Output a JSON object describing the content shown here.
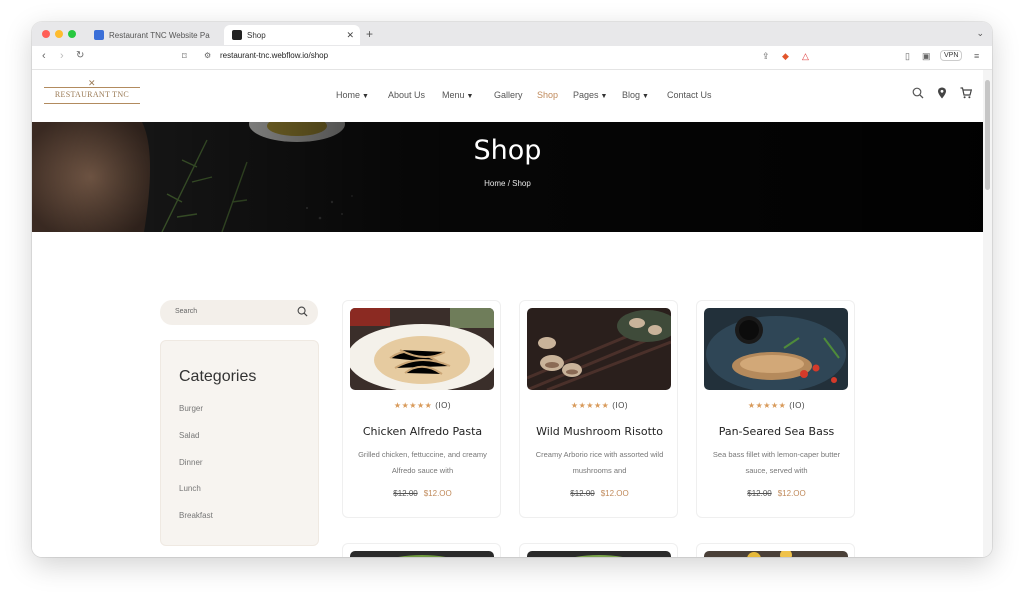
{
  "browser": {
    "tabs": [
      {
        "label": "Restaurant TNC Website Page Tr"
      },
      {
        "label": "Shop"
      }
    ],
    "url": "restaurant-tnc.webflow.io/shop",
    "vpn_label": "VPN"
  },
  "site": {
    "logo_text": "RESTAURANT TNC",
    "nav": [
      {
        "label": "Home",
        "dropdown": true
      },
      {
        "label": "About Us",
        "dropdown": false
      },
      {
        "label": "Menu",
        "dropdown": true
      },
      {
        "label": "Gallery",
        "dropdown": false
      },
      {
        "label": "Shop",
        "dropdown": false
      },
      {
        "label": "Pages",
        "dropdown": true
      },
      {
        "label": "Blog",
        "dropdown": true
      },
      {
        "label": "Contact Us",
        "dropdown": false
      }
    ]
  },
  "hero": {
    "title": "Shop",
    "breadcrumb": "Home / Shop"
  },
  "sidebar": {
    "search_placeholder": "Search",
    "categories_title": "Categories",
    "categories": [
      "Burger",
      "Salad",
      "Dinner",
      "Lunch",
      "Breakfast"
    ]
  },
  "products": [
    {
      "title": "Chicken Alfredo Pasta",
      "description": "Grilled chicken, fettuccine, and creamy Alfredo sauce with",
      "rating_count": "(IO)",
      "old_price": "$12.00",
      "price": "$12.OO"
    },
    {
      "title": "Wild Mushroom Risotto",
      "description": "Creamy Arborio rice with assorted wild mushrooms and",
      "rating_count": "(IO)",
      "old_price": "$12.00",
      "price": "$12.OO"
    },
    {
      "title": "Pan-Seared Sea Bass",
      "description": "Sea bass fillet with lemon-caper butter sauce, served with",
      "rating_count": "(IO)",
      "old_price": "$12.00",
      "price": "$12.OO"
    }
  ],
  "colors": {
    "accent": "#c08a5b",
    "star": "#d89a5a",
    "hero_bg": "#0d0d0d",
    "sidebar_bg": "#f7f4f0"
  }
}
